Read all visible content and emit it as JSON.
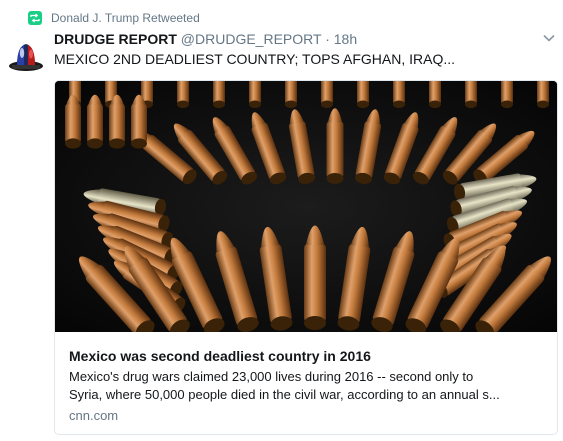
{
  "retweet": {
    "label": "Donald J. Trump Retweeted",
    "icon": "retweet-icon",
    "color": "#19cf86"
  },
  "tweet": {
    "name": "DRUDGE REPORT",
    "handle": "@DRUDGE_REPORT",
    "separator": "·",
    "time": "18h",
    "text": "MEXICO 2ND DEADLIEST COUNTRY; TOPS AFGHAN, IRAQ...",
    "menu_icon": "chevron-down-icon",
    "avatar_icon": "siren-icon"
  },
  "card": {
    "image_description_icon": "bullets-image",
    "title": "Mexico was second deadliest country in 2016",
    "description_line1": "Mexico's drug wars claimed 23,000 lives during 2016 -- second only to",
    "description_line2": "Syria, where 50,000 people died in the civil war, according to an annual s...",
    "domain": "cnn.com"
  }
}
